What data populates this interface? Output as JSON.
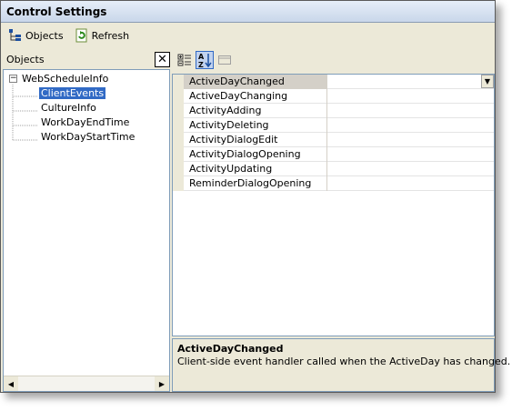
{
  "window": {
    "title": "Control Settings"
  },
  "toolbar": {
    "objects_label": "Objects",
    "objects_icon": "objects-tree-icon",
    "refresh_label": "Refresh",
    "refresh_icon": "refresh-icon"
  },
  "left_panel": {
    "header": "Objects",
    "close_glyph": "✕",
    "tree": {
      "root": {
        "label": "WebScheduleInfo",
        "expander": "−"
      },
      "children": [
        {
          "label": "ClientEvents",
          "selected": true
        },
        {
          "label": "CultureInfo",
          "selected": false
        },
        {
          "label": "WorkDayEndTime",
          "selected": false
        },
        {
          "label": "WorkDayStartTime",
          "selected": false
        }
      ]
    }
  },
  "property_toolbar": {
    "categorized_icon": "categorized-view-icon",
    "alphabetical_icon": "alphabetical-sort-icon",
    "property_pages_icon": "property-pages-icon"
  },
  "properties": [
    {
      "name": "ActiveDayChanged",
      "value": "",
      "selected": true
    },
    {
      "name": "ActiveDayChanging",
      "value": "",
      "selected": false
    },
    {
      "name": "ActivityAdding",
      "value": "",
      "selected": false
    },
    {
      "name": "ActivityDeleting",
      "value": "",
      "selected": false
    },
    {
      "name": "ActivityDialogEdit",
      "value": "",
      "selected": false
    },
    {
      "name": "ActivityDialogOpening",
      "value": "",
      "selected": false
    },
    {
      "name": "ActivityUpdating",
      "value": "",
      "selected": false
    },
    {
      "name": "ReminderDialogOpening",
      "value": "",
      "selected": false
    }
  ],
  "description": {
    "title": "ActiveDayChanged",
    "text": "Client-side event handler called when the ActiveDay has changed."
  },
  "colors": {
    "selection": "#316ac5",
    "panel": "#ece9d8",
    "border": "#7f9db9"
  }
}
